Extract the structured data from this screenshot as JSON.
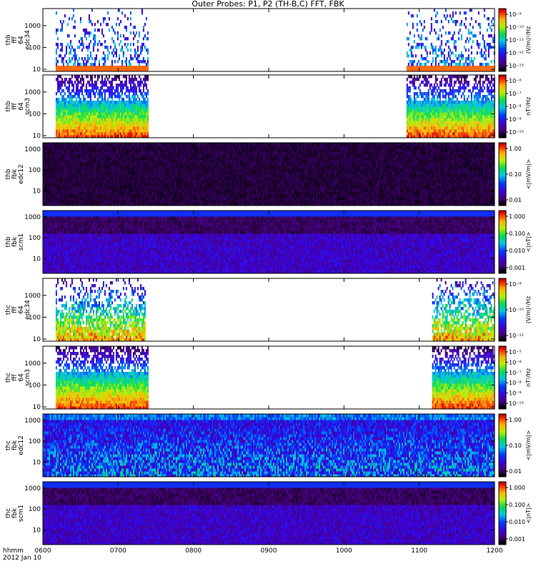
{
  "chart_data": {
    "type": "heatmap",
    "title": "Outer Probes: P1, P2 (TH-B,C) FFT, FBK",
    "x": {
      "range": [
        6.0,
        12.0
      ],
      "ticks": [
        6,
        7,
        8,
        9,
        10,
        11,
        12
      ],
      "tick_labels": [
        "0600",
        "0700",
        "0800",
        "0900",
        "1000",
        "1100",
        "1200"
      ],
      "axis_label": "hhmm",
      "date_label": "2012 Jan 10"
    },
    "panels": [
      {
        "id": "thb-fff-edc34",
        "label": [
          "thb",
          "fff",
          "64",
          "edc34"
        ],
        "y_ticks": [
          "10",
          "100",
          "1000"
        ],
        "y_log": true,
        "y_range": [
          8,
          6000
        ],
        "cb_ticks": [
          "10⁻⁹",
          "10⁻¹⁰",
          "10⁻¹¹",
          "10⁻¹²",
          "10⁻¹³"
        ],
        "cb_label": "(V/m)²/Hz",
        "data_intervals": [
          [
            6.17,
            7.4
          ],
          [
            10.83,
            12.0
          ]
        ],
        "style": "sparse"
      },
      {
        "id": "thb-fff-scm3",
        "label": [
          "thb",
          "fff",
          "64",
          "scm3"
        ],
        "y_ticks": [
          "10",
          "100",
          "1000"
        ],
        "y_log": true,
        "y_range": [
          8,
          6000
        ],
        "cb_ticks": [
          "10⁻⁶",
          "10⁻⁷",
          "10⁻⁸",
          "10⁻⁹",
          "10⁻¹⁰"
        ],
        "cb_label": "nT²/Hz",
        "data_intervals": [
          [
            6.17,
            7.4
          ],
          [
            10.83,
            12.0
          ]
        ],
        "style": "banded"
      },
      {
        "id": "thb-fbk-edc12",
        "label": [
          "thb",
          "fbk",
          "edc12"
        ],
        "y_ticks": [
          "10",
          "100",
          "1000"
        ],
        "y_log": true,
        "y_range": [
          2,
          2000
        ],
        "cb_ticks": [
          "1.00",
          "0.10",
          "0.01"
        ],
        "cb_label": "<|mV/m|>",
        "data_intervals": [
          [
            6.0,
            12.0
          ]
        ],
        "style": "dark"
      },
      {
        "id": "thb-fbk-scm1",
        "label": [
          "thb",
          "fbk",
          "scm1"
        ],
        "y_ticks": [
          "10",
          "100",
          "1000"
        ],
        "y_log": true,
        "y_range": [
          2,
          2000
        ],
        "cb_ticks": [
          "1.000",
          "0.100",
          "0.010",
          "0.001"
        ],
        "cb_label": "<|nT|>",
        "data_intervals": [
          [
            6.0,
            12.0
          ]
        ],
        "style": "fbk-scm"
      },
      {
        "id": "thc-fff-edc34",
        "label": [
          "thc",
          "fff",
          "64",
          "edc34"
        ],
        "y_ticks": [
          "10",
          "100",
          "1000"
        ],
        "y_log": true,
        "y_range": [
          8,
          6000
        ],
        "cb_ticks": [
          "10⁻⁸",
          "10⁻¹⁰",
          "10⁻¹²"
        ],
        "cb_label": "(V/m)²/Hz",
        "data_intervals": [
          [
            6.17,
            7.35
          ],
          [
            11.17,
            12.0
          ]
        ],
        "style": "spiky"
      },
      {
        "id": "thc-fff-scm3",
        "label": [
          "thc",
          "fff",
          "64",
          "scm3"
        ],
        "y_ticks": [
          "10",
          "100",
          "1000"
        ],
        "y_log": true,
        "y_range": [
          8,
          6000
        ],
        "cb_ticks": [
          "10⁻⁵",
          "10⁻⁶",
          "10⁻⁷",
          "10⁻⁸",
          "10⁻⁹",
          "10⁻¹⁰"
        ],
        "cb_label": "nT²/Hz",
        "data_intervals": [
          [
            6.17,
            7.4
          ],
          [
            11.17,
            12.0
          ]
        ],
        "style": "banded"
      },
      {
        "id": "thc-fbk-edc12",
        "label": [
          "thc",
          "fbk",
          "edc12"
        ],
        "y_ticks": [
          "10",
          "100",
          "1000"
        ],
        "y_log": true,
        "y_range": [
          2,
          2000
        ],
        "cb_ticks": [
          "1.00",
          "0.10",
          "0.01"
        ],
        "cb_label": "<|mV/m|>",
        "data_intervals": [
          [
            6.0,
            12.0
          ]
        ],
        "style": "fbk-edc"
      },
      {
        "id": "thc-fbk-scm1",
        "label": [
          "thc",
          "fbk",
          "scm1"
        ],
        "y_ticks": [
          "10",
          "100",
          "1000"
        ],
        "y_log": true,
        "y_range": [
          2,
          2000
        ],
        "cb_ticks": [
          "1.000",
          "0.100",
          "0.010",
          "0.001"
        ],
        "cb_label": "<|nT|>",
        "data_intervals": [
          [
            6.0,
            12.0
          ]
        ],
        "style": "fbk-scm"
      }
    ]
  }
}
